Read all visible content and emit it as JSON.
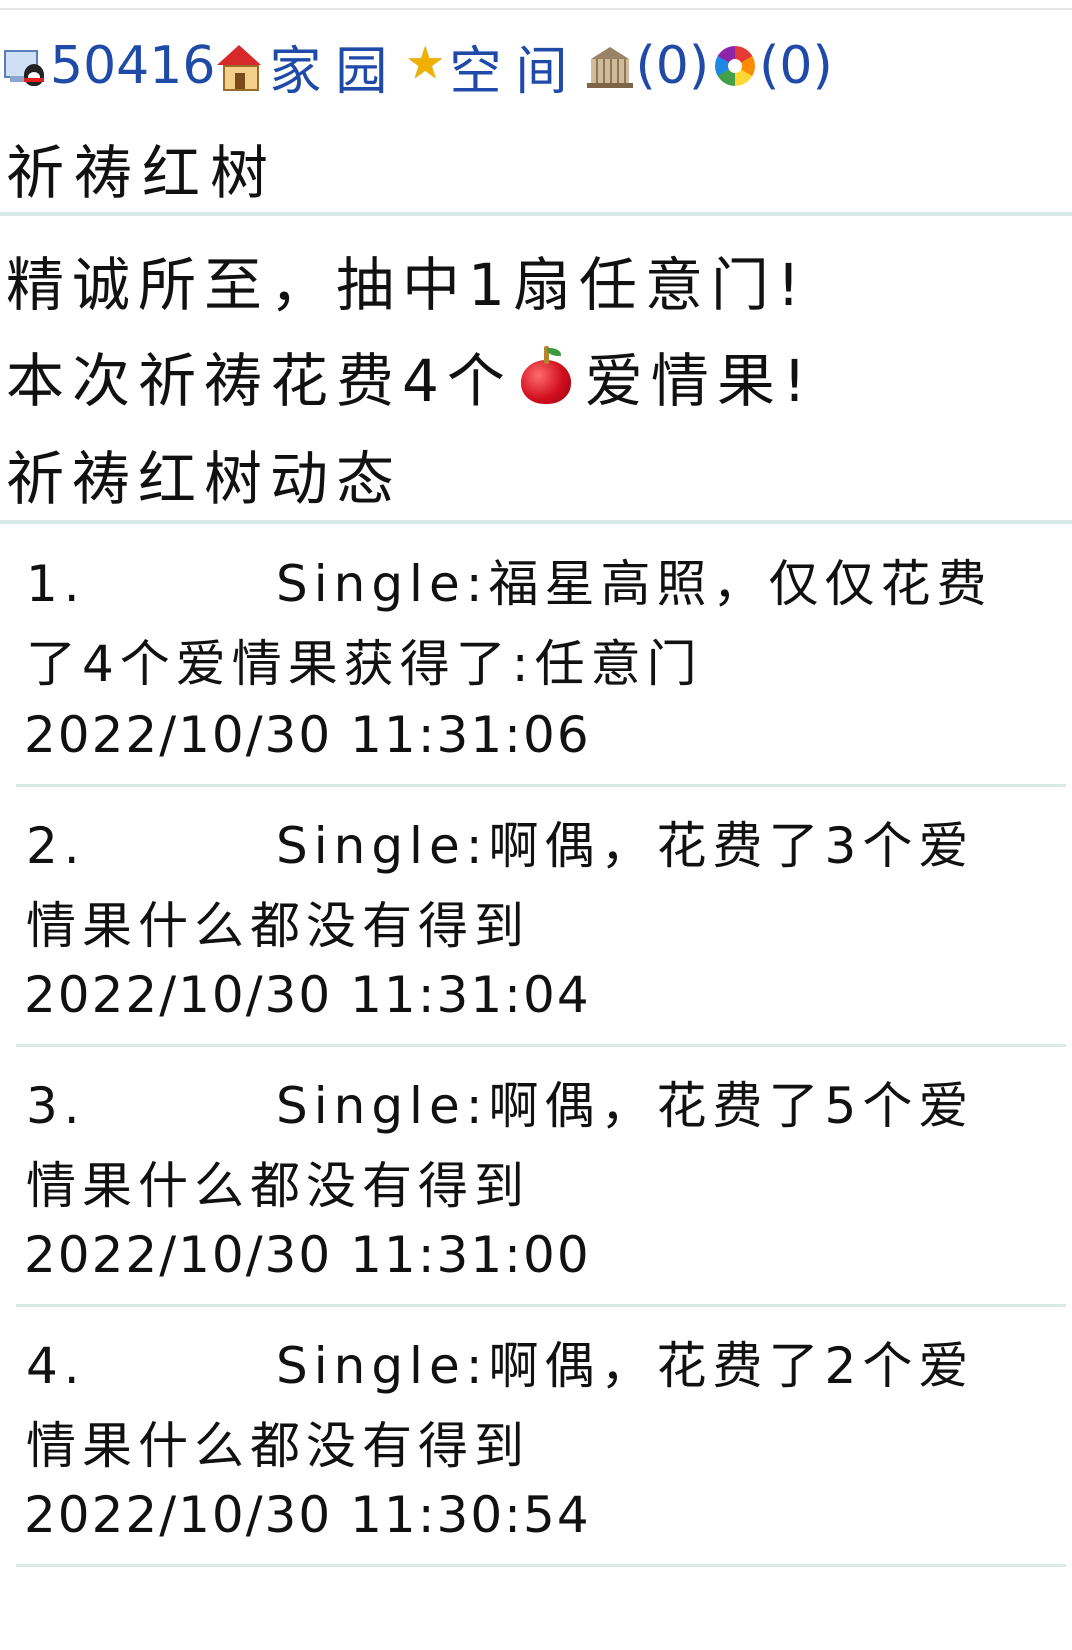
{
  "nav": {
    "user_id": "50416",
    "home_label": "家园",
    "space_label": "空间",
    "mail_count": "(0)",
    "album_count": "(0)"
  },
  "page_title": "祈祷红树",
  "result": {
    "line1": "精诚所至，抽中1扇任意门!",
    "line2_prefix": "本次祈祷花费4个",
    "line2_suffix": "爱情果!"
  },
  "feed_title": "祈祷红树动态",
  "feed": [
    {
      "no": "1.",
      "text_line1": "Single:福星高照，仅仅花费",
      "text_line2": "了4个爱情果获得了:任意门",
      "time": "2022/10/30 11:31:06"
    },
    {
      "no": "2.",
      "text_line1": "Single:啊偶，花费了3个爱",
      "text_line2": "情果什么都没有得到",
      "time": "2022/10/30 11:31:04"
    },
    {
      "no": "3.",
      "text_line1": "Single:啊偶，花费了5个爱",
      "text_line2": "情果什么都没有得到",
      "time": "2022/10/30 11:31:00"
    },
    {
      "no": "4.",
      "text_line1": "Single:啊偶，花费了2个爱",
      "text_line2": "情果什么都没有得到",
      "time": "2022/10/30 11:30:54"
    }
  ],
  "colors": {
    "link": "#1f4aa8",
    "divider": "#d8ebe6",
    "text": "#111111"
  },
  "icons": [
    "qq-online-icon",
    "house-icon",
    "star-icon",
    "temple-icon",
    "color-wheel-icon",
    "apple-icon"
  ]
}
